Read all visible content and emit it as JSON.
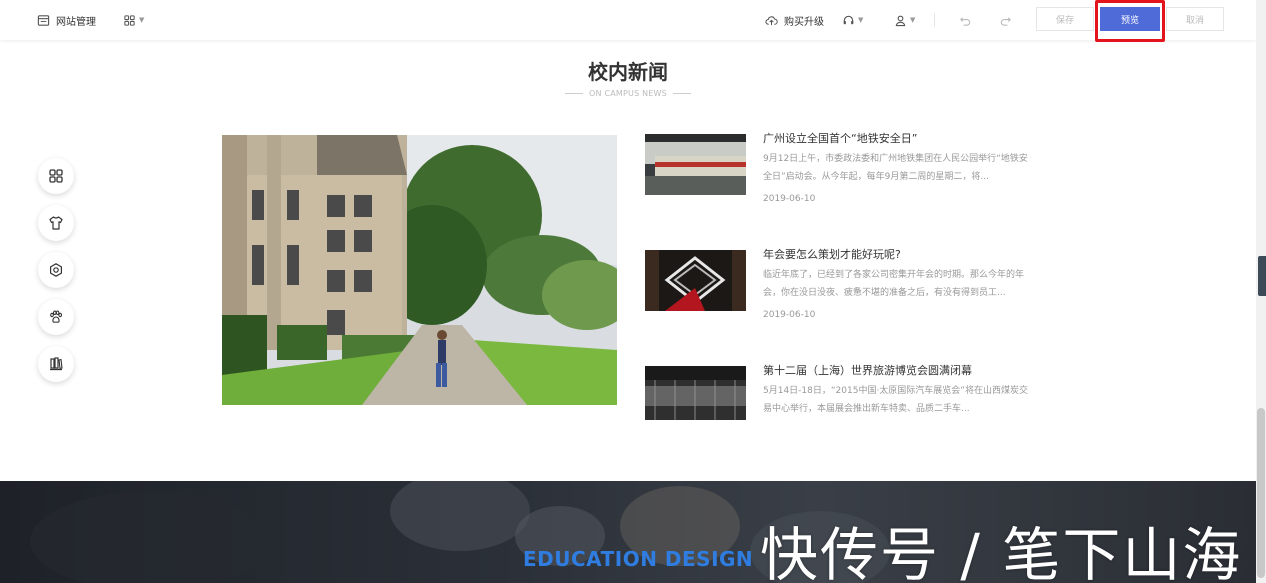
{
  "toolbar": {
    "site_manage": "网站管理",
    "buy_upgrade": "购买升级",
    "save": "保存",
    "preview": "预览",
    "cancel": "取消"
  },
  "section": {
    "title": "校内新闻",
    "subtitle": "ON CAMPUS NEWS"
  },
  "news": [
    {
      "title": "广州设立全国首个“地铁安全日”",
      "desc": "9月12日上午，市委政法委和广州地铁集团在人民公园举行“地铁安全日”启动会。从今年起，每年9月第二周的星期二，将...",
      "date": "2019-06-10"
    },
    {
      "title": "年会要怎么策划才能好玩呢?",
      "desc": "临近年底了，已经到了各家公司密集开年会的时期。那么今年的年会，你在没日没夜、疲惫不堪的准备之后，有没有得到员工...",
      "date": "2019-06-10"
    },
    {
      "title": "第十二届（上海）世界旅游博览会圆满闭幕",
      "desc": "5月14日-18日，“2015中国·太原国际汽车展览会”将在山西煤炭交易中心举行，本届展会推出新车特卖、品质二手车...",
      "date": ""
    }
  ],
  "banner": {
    "title": "EDUCATION DESIGN"
  },
  "watermark": "快传号 / 笔下山海",
  "colors": {
    "accent": "#4f6bd8",
    "highlight": "#e3141c",
    "banner_title": "#2f7de0"
  },
  "icons": {
    "left_tools": [
      "apps-icon",
      "shirt-icon",
      "settings-icon",
      "paw-icon",
      "layers-icon"
    ]
  }
}
